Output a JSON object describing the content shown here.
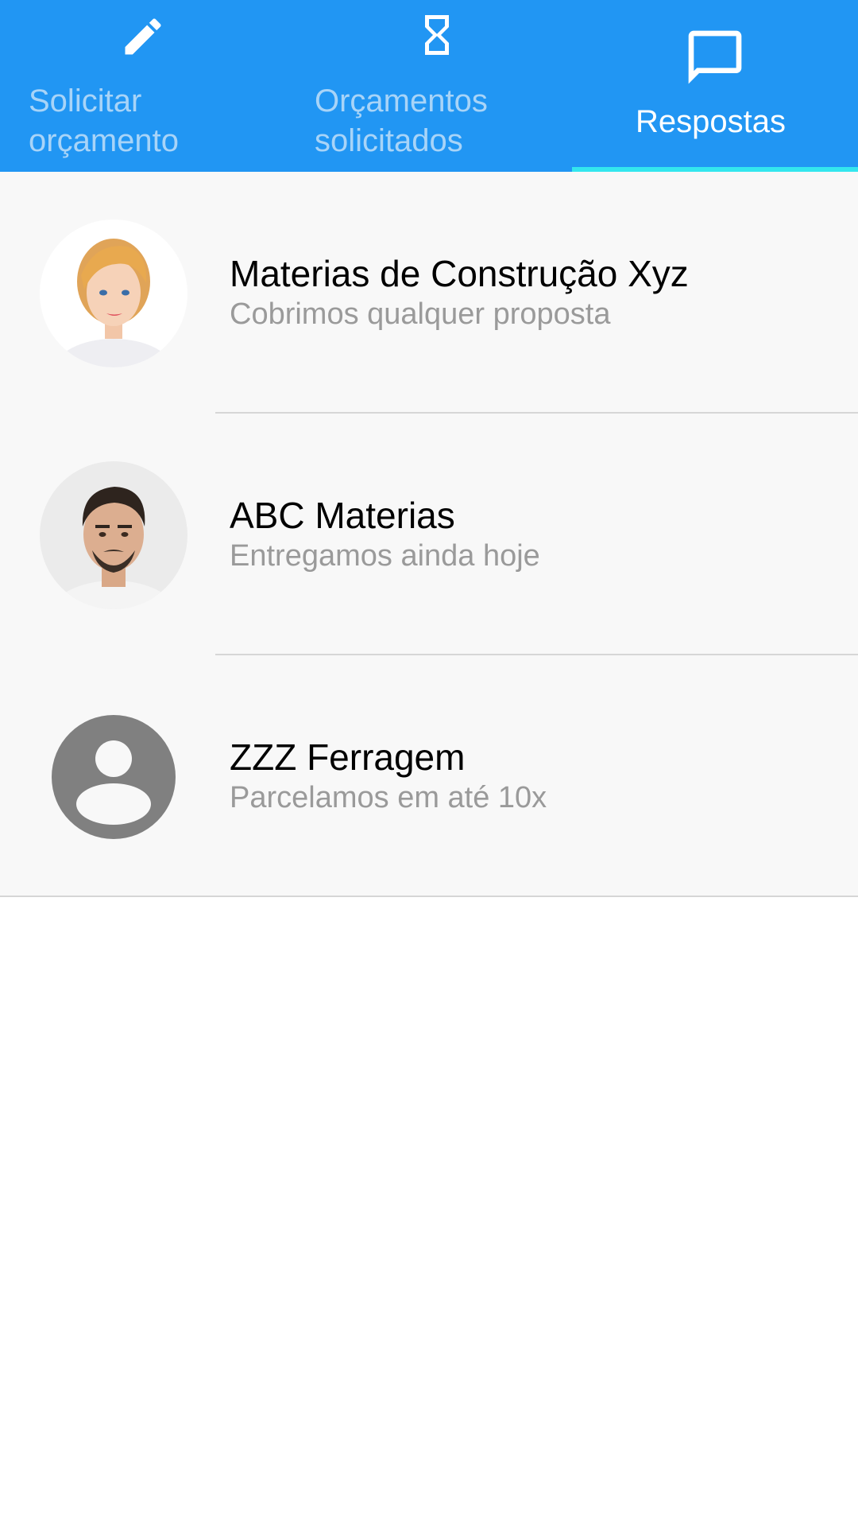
{
  "tabs": [
    {
      "label": "Solicitar\norçamento",
      "icon": "pencil-icon",
      "active": false
    },
    {
      "label": "Orçamentos\nsolicitados",
      "icon": "hourglass-icon",
      "active": false
    },
    {
      "label": "Respostas",
      "icon": "chat-bubble-icon",
      "active": true
    }
  ],
  "responses": [
    {
      "name": "Materias de Construção Xyz",
      "message": "Cobrimos qualquer proposta",
      "avatar": "woman-photo-avatar"
    },
    {
      "name": "ABC Materias",
      "message": "Entregamos ainda hoje",
      "avatar": "man-photo-avatar"
    },
    {
      "name": "ZZZ Ferragem",
      "message": "Parcelamos em até 10x",
      "avatar": "default-person-icon"
    }
  ],
  "colors": {
    "tabbar": "#2196f3",
    "indicator": "#33e6ee",
    "tab_inactive_text": "#a8d4f8",
    "tab_active_text": "#ffffff",
    "list_background": "#f8f8f8",
    "subtitle_text": "#9a9a9a",
    "placeholder_avatar": "#808080"
  }
}
